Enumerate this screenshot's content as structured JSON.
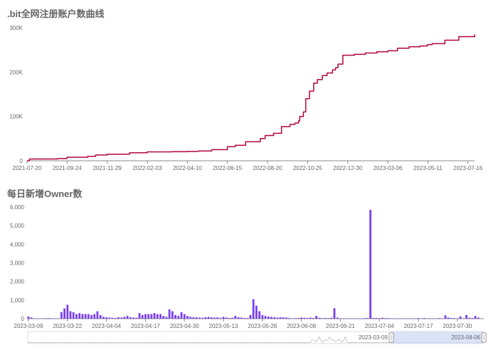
{
  "chart_data": [
    {
      "type": "line",
      "title": ".bit全网注册账户数曲线",
      "xlabel": "",
      "ylabel": "",
      "ylim": [
        0,
        300000
      ],
      "xlim": [
        "2021-07-20",
        "2023-07-27"
      ],
      "y_ticks": [
        0,
        100000,
        200000,
        300000
      ],
      "y_tick_labels": [
        "0",
        "100K",
        "200K",
        "300K"
      ],
      "x_tick_labels": [
        "2021-07-20",
        "2021-09-24",
        "2021-11-29",
        "2022-02-03",
        "2022-04-10",
        "2022-06-15",
        "2022-08-20",
        "2022-10-25",
        "2022-12-30",
        "2023-03-06",
        "2023-05-11",
        "2023-07-16"
      ],
      "grid": false,
      "color": "#b1063a",
      "series": [
        {
          "x": [
            "2021-07-20",
            "2021-07-24",
            "2021-09-08",
            "2021-09-24",
            "2021-10-28",
            "2021-11-10",
            "2021-11-29",
            "2022-01-05",
            "2022-02-03",
            "2022-03-15",
            "2022-04-10",
            "2022-04-28",
            "2022-05-20",
            "2022-06-15",
            "2022-06-28",
            "2022-07-15",
            "2022-08-08",
            "2022-08-16",
            "2022-08-30",
            "2022-09-12",
            "2022-09-26",
            "2022-10-04",
            "2022-10-10",
            "2022-10-12",
            "2022-10-18",
            "2022-10-22",
            "2022-10-28",
            "2022-11-04",
            "2022-11-10",
            "2022-11-18",
            "2022-11-26",
            "2022-12-05",
            "2022-12-10",
            "2022-12-14",
            "2022-12-22",
            "2023-01-10",
            "2023-01-28",
            "2023-02-16",
            "2023-03-06",
            "2023-03-22",
            "2023-04-10",
            "2023-04-28",
            "2023-05-10",
            "2023-05-18",
            "2023-06-08",
            "2023-07-01",
            "2023-07-27"
          ],
          "values": [
            0,
            4000,
            5000,
            8000,
            10000,
            13000,
            15000,
            18000,
            20000,
            20500,
            21000,
            22000,
            25000,
            32000,
            35000,
            43000,
            50000,
            57000,
            62000,
            77000,
            82000,
            85000,
            90000,
            100000,
            110000,
            140000,
            157000,
            175000,
            183000,
            192000,
            198000,
            205000,
            210000,
            218000,
            238000,
            240000,
            243000,
            246000,
            248000,
            254000,
            257000,
            259000,
            262000,
            264000,
            272000,
            280000,
            285000
          ]
        }
      ]
    },
    {
      "type": "bar",
      "title": "每日新增Owner数",
      "xlabel": "",
      "ylabel": "",
      "ylim": [
        0,
        6000
      ],
      "y_ticks": [
        0,
        1000,
        2000,
        3000,
        4000,
        5000,
        6000
      ],
      "y_tick_labels": [
        "0",
        "1,000",
        "2,000",
        "3,000",
        "4,000",
        "5,000",
        "6,000"
      ],
      "x_tick_labels": [
        "2023-03-09",
        "2023-03-22",
        "2023-04-04",
        "2023-04-17",
        "2023-04-30",
        "2023-05-13",
        "2023-05-26",
        "2023-06-08",
        "2023-06-21",
        "2023-07-04",
        "2023-07-17",
        "2023-07-30"
      ],
      "grid": false,
      "color": "#7b3ff2",
      "categories": [
        "2023-03-09",
        "2023-03-10",
        "2023-03-11",
        "2023-03-12",
        "2023-03-13",
        "2023-03-14",
        "2023-03-15",
        "2023-03-16",
        "2023-03-17",
        "2023-03-18",
        "2023-03-19",
        "2023-03-20",
        "2023-03-21",
        "2023-03-22",
        "2023-03-23",
        "2023-03-24",
        "2023-03-25",
        "2023-03-26",
        "2023-03-27",
        "2023-03-28",
        "2023-03-29",
        "2023-03-30",
        "2023-03-31",
        "2023-04-01",
        "2023-04-02",
        "2023-04-03",
        "2023-04-04",
        "2023-04-05",
        "2023-04-06",
        "2023-04-07",
        "2023-04-08",
        "2023-04-09",
        "2023-04-10",
        "2023-04-11",
        "2023-04-12",
        "2023-04-13",
        "2023-04-14",
        "2023-04-15",
        "2023-04-16",
        "2023-04-17",
        "2023-04-18",
        "2023-04-19",
        "2023-04-20",
        "2023-04-21",
        "2023-04-22",
        "2023-04-23",
        "2023-04-24",
        "2023-04-25",
        "2023-04-26",
        "2023-04-27",
        "2023-04-28",
        "2023-04-29",
        "2023-04-30",
        "2023-05-01",
        "2023-05-02",
        "2023-05-03",
        "2023-05-04",
        "2023-05-05",
        "2023-05-06",
        "2023-05-07",
        "2023-05-08",
        "2023-05-09",
        "2023-05-10",
        "2023-05-11",
        "2023-05-12",
        "2023-05-13",
        "2023-05-14",
        "2023-05-15",
        "2023-05-16",
        "2023-05-17",
        "2023-05-18",
        "2023-05-19",
        "2023-05-20",
        "2023-05-21",
        "2023-05-22",
        "2023-05-23",
        "2023-05-24",
        "2023-05-25",
        "2023-05-26",
        "2023-05-27",
        "2023-05-28",
        "2023-05-29",
        "2023-05-30",
        "2023-05-31",
        "2023-06-01",
        "2023-06-02",
        "2023-06-03",
        "2023-06-04",
        "2023-06-05",
        "2023-06-06",
        "2023-06-07",
        "2023-06-08",
        "2023-06-09",
        "2023-06-10",
        "2023-06-11",
        "2023-06-12",
        "2023-06-13",
        "2023-06-14",
        "2023-06-15",
        "2023-06-16",
        "2023-06-17",
        "2023-06-18",
        "2023-06-19",
        "2023-06-20",
        "2023-06-21",
        "2023-06-22",
        "2023-06-23",
        "2023-06-24",
        "2023-06-25",
        "2023-06-26",
        "2023-06-27",
        "2023-06-28",
        "2023-06-29",
        "2023-06-30",
        "2023-07-01",
        "2023-07-02",
        "2023-07-03",
        "2023-07-04",
        "2023-07-05",
        "2023-07-06",
        "2023-07-07",
        "2023-07-08",
        "2023-07-09",
        "2023-07-10",
        "2023-07-11",
        "2023-07-12",
        "2023-07-13",
        "2023-07-14",
        "2023-07-15",
        "2023-07-16",
        "2023-07-17",
        "2023-07-18",
        "2023-07-19",
        "2023-07-20",
        "2023-07-21",
        "2023-07-22",
        "2023-07-23",
        "2023-07-24",
        "2023-07-25",
        "2023-07-26",
        "2023-07-27",
        "2023-07-28",
        "2023-07-29",
        "2023-07-30",
        "2023-07-31",
        "2023-08-01",
        "2023-08-02",
        "2023-08-03",
        "2023-08-04",
        "2023-08-05",
        "2023-08-06"
      ],
      "values": [
        120,
        60,
        20,
        10,
        15,
        20,
        25,
        30,
        20,
        15,
        20,
        350,
        550,
        750,
        400,
        350,
        250,
        300,
        250,
        250,
        250,
        200,
        250,
        400,
        200,
        100,
        80,
        60,
        50,
        40,
        80,
        60,
        100,
        150,
        80,
        60,
        50,
        300,
        200,
        250,
        250,
        250,
        300,
        250,
        250,
        150,
        100,
        500,
        400,
        200,
        150,
        350,
        250,
        150,
        100,
        80,
        80,
        60,
        50,
        80,
        100,
        80,
        60,
        70,
        50,
        100,
        60,
        40,
        50,
        150,
        80,
        60,
        40,
        40,
        200,
        1050,
        700,
        400,
        200,
        150,
        120,
        100,
        80,
        60,
        80,
        70,
        60,
        40,
        20,
        30,
        40,
        60,
        50,
        40,
        60,
        40,
        150,
        50,
        30,
        40,
        30,
        50,
        560,
        60,
        20,
        10,
        15,
        20,
        20,
        10,
        15,
        20,
        30,
        40,
        5850,
        40,
        40,
        30,
        50,
        30,
        30,
        20,
        10,
        20,
        15,
        10,
        20,
        15,
        10,
        20,
        30,
        20,
        40,
        20,
        20,
        15,
        20,
        30,
        20,
        180,
        60,
        40,
        30,
        20,
        120,
        20,
        200,
        50,
        40,
        150,
        60
      ]
    }
  ],
  "zoom": {
    "start_label": "2023-03-09",
    "end_label": "2023-08-06",
    "window_start_fraction": 0.797,
    "window_end_fraction": 1.0,
    "overview_color": "#a6a6a6",
    "window_color": "#d2dcf7"
  }
}
